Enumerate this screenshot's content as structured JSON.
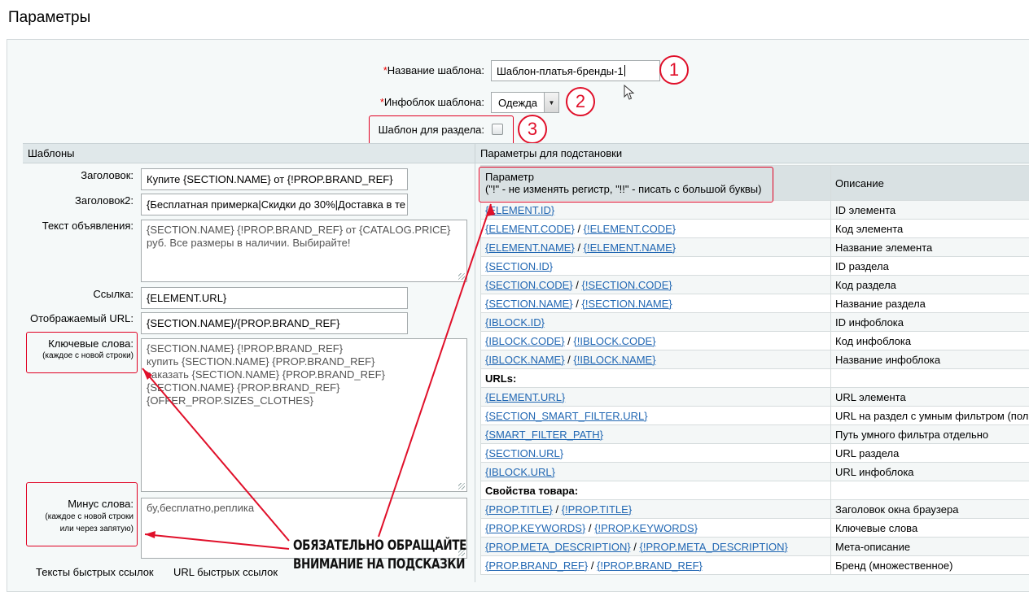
{
  "page": {
    "title": "Параметры"
  },
  "form": {
    "template_name": {
      "required_mark": "*",
      "label": "Название шаблона:",
      "value": "Шаблон-платья-бренды-1"
    },
    "iblock": {
      "required_mark": "*",
      "label": "Инфоблок шаблона:",
      "value": "Одежда"
    },
    "section_template": {
      "label": "Шаблон для раздела:"
    }
  },
  "callouts": [
    "1",
    "2",
    "3"
  ],
  "templates": {
    "header": "Шаблоны",
    "title": {
      "label": "Заголовок:",
      "value": "Купите {SECTION.NAME} от {!PROP.BRAND_REF}"
    },
    "title2": {
      "label": "Заголовок2:",
      "value": "{Бесплатная примерка|Скидки до 30%|Доставка в те"
    },
    "ad_text": {
      "label": "Текст объявления:",
      "lines": [
        "{SECTION.NAME} {!PROP.BRAND_REF} от {CATALOG.PRICE}",
        "руб. Все размеры в наличии. Выбирайте!"
      ]
    },
    "link": {
      "label": "Ссылка:",
      "value": "{ELEMENT.URL}"
    },
    "display_url": {
      "label": "Отображаемый URL:",
      "value": "{SECTION.NAME}/{PROP.BRAND_REF}"
    },
    "keywords": {
      "label": "Ключевые слова:",
      "hint": "(каждое с новой строки)",
      "lines": [
        "{SECTION.NAME} {!PROP.BRAND_REF}",
        "купить {SECTION.NAME} {PROP.BRAND_REF}",
        "заказать {SECTION.NAME} {PROP.BRAND_REF}",
        "{SECTION.NAME} {PROP.BRAND_REF}",
        "{OFFER_PROP.SIZES_CLOTHES}"
      ]
    },
    "minus_words": {
      "label": "Минус слова:",
      "hint1": "(каждое с новой строки",
      "hint2": "или через запятую)",
      "value": "бу,бесплатно,реплика"
    },
    "quick_links_texts": "Тексты быстрых ссылок",
    "quick_links_urls": "URL быстрых ссылок"
  },
  "annotation": {
    "line1": "ОБЯЗАТЕЛЬНО ОБРАЩАЙТЕ",
    "line2": "ВНИМАНИЕ НА ПОДСКАЗКИ"
  },
  "substitution": {
    "header": "Параметры для подстановки",
    "col_param": "Параметр",
    "col_param_hint": "(\"!\" - не изменять регистр, \"!!\" - писать с большой буквы)",
    "col_desc": "Описание",
    "rows": [
      {
        "links": [
          "{ELEMENT.ID}"
        ],
        "desc": "ID элемента"
      },
      {
        "links": [
          "{ELEMENT.CODE}",
          "{!ELEMENT.CODE}"
        ],
        "desc": "Код элемента"
      },
      {
        "links": [
          "{ELEMENT.NAME}",
          "{!ELEMENT.NAME}"
        ],
        "desc": "Название элемента"
      },
      {
        "links": [
          "{SECTION.ID}"
        ],
        "desc": "ID раздела"
      },
      {
        "links": [
          "{SECTION.CODE}",
          "{!SECTION.CODE}"
        ],
        "desc": "Код раздела"
      },
      {
        "links": [
          "{SECTION.NAME}",
          "{!SECTION.NAME}"
        ],
        "desc": "Название раздела"
      },
      {
        "links": [
          "{IBLOCK.ID}"
        ],
        "desc": "ID инфоблока"
      },
      {
        "links": [
          "{IBLOCK.CODE}",
          "{!IBLOCK.CODE}"
        ],
        "desc": "Код инфоблока"
      },
      {
        "links": [
          "{IBLOCK.NAME}",
          "{!IBLOCK.NAME}"
        ],
        "desc": "Название инфоблока"
      },
      {
        "group": "URLs:"
      },
      {
        "links": [
          "{ELEMENT.URL}"
        ],
        "desc": "URL элемента"
      },
      {
        "links": [
          "{SECTION_SMART_FILTER.URL}"
        ],
        "desc": "URL на раздел с умным фильтром (полн"
      },
      {
        "links": [
          "{SMART_FILTER_PATH}"
        ],
        "desc": "Путь умного фильтра отдельно"
      },
      {
        "links": [
          "{SECTION.URL}"
        ],
        "desc": "URL раздела"
      },
      {
        "links": [
          "{IBLOCK.URL}"
        ],
        "desc": "URL инфоблока"
      },
      {
        "group": "Свойства товара:"
      },
      {
        "links": [
          "{PROP.TITLE}",
          "{!PROP.TITLE}"
        ],
        "desc": "Заголовок окна браузера"
      },
      {
        "links": [
          "{PROP.KEYWORDS}",
          "{!PROP.KEYWORDS}"
        ],
        "desc": "Ключевые слова"
      },
      {
        "links": [
          "{PROP.META_DESCRIPTION}",
          "{!PROP.META_DESCRIPTION}"
        ],
        "desc": "Мета-описание"
      },
      {
        "links": [
          "{PROP.BRAND_REF}",
          "{!PROP.BRAND_REF}"
        ],
        "desc": "Бренд (множественное)"
      }
    ]
  },
  "colors": {
    "accent_red": "#e0102a",
    "link": "#2167b3",
    "header_bg": "#e0e8ea"
  }
}
